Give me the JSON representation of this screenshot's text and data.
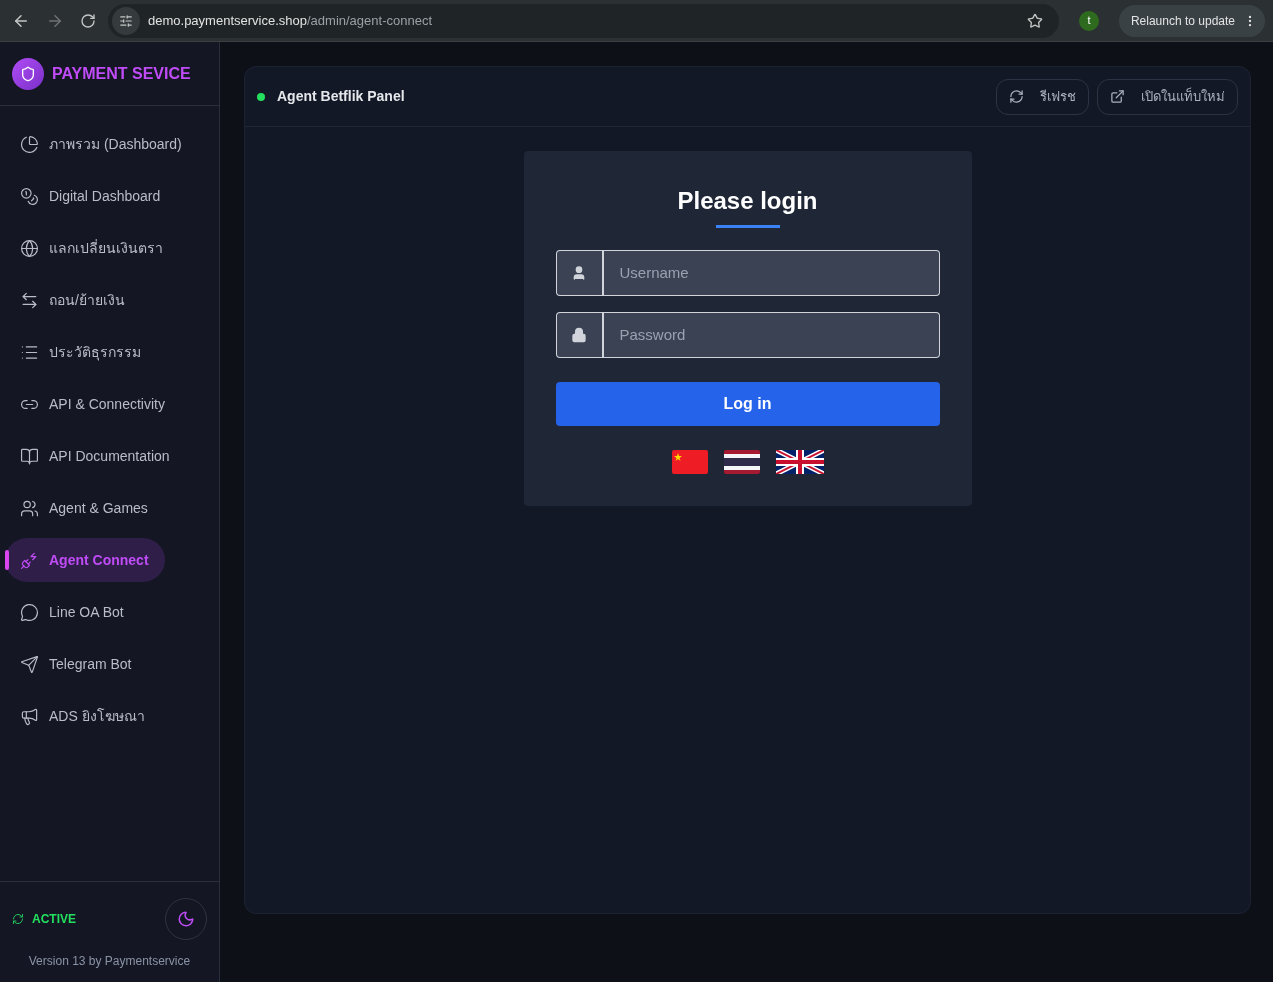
{
  "browser": {
    "url_host": "demo.paymentservice.shop",
    "url_path": "/admin/agent-connect",
    "profile_initial": "t",
    "relaunch": "Relaunch to update"
  },
  "sidebar": {
    "brand": "PAYMENT SEVICE",
    "items": [
      {
        "label": "ภาพรวม (Dashboard)",
        "selected": false
      },
      {
        "label": "Digital Dashboard",
        "selected": false
      },
      {
        "label": "แลกเปลี่ยนเงินตรา",
        "selected": false
      },
      {
        "label": "ถอน/ย้ายเงิน",
        "selected": false
      },
      {
        "label": "ประวัติธุรกรรม",
        "selected": false
      },
      {
        "label": "API & Connectivity",
        "selected": false
      },
      {
        "label": "API Documentation",
        "selected": false
      },
      {
        "label": "Agent & Games",
        "selected": false
      },
      {
        "label": "Agent Connect",
        "selected": true
      },
      {
        "label": "Line OA Bot",
        "selected": false
      },
      {
        "label": "Telegram Bot",
        "selected": false
      },
      {
        "label": "ADS ยิงโฆษณา",
        "selected": false
      }
    ],
    "status": "ACTIVE",
    "version": "Version 13 by Paymentservice"
  },
  "panel": {
    "title": "Agent Betflik Panel",
    "online": true,
    "buttons": [
      "รีเฟรช",
      "เปิดในแท็บใหม่"
    ]
  },
  "login": {
    "title": "Please login",
    "username": {
      "placeholder": "Username"
    },
    "password": {
      "placeholder": "Password"
    },
    "submit": "Log in"
  }
}
